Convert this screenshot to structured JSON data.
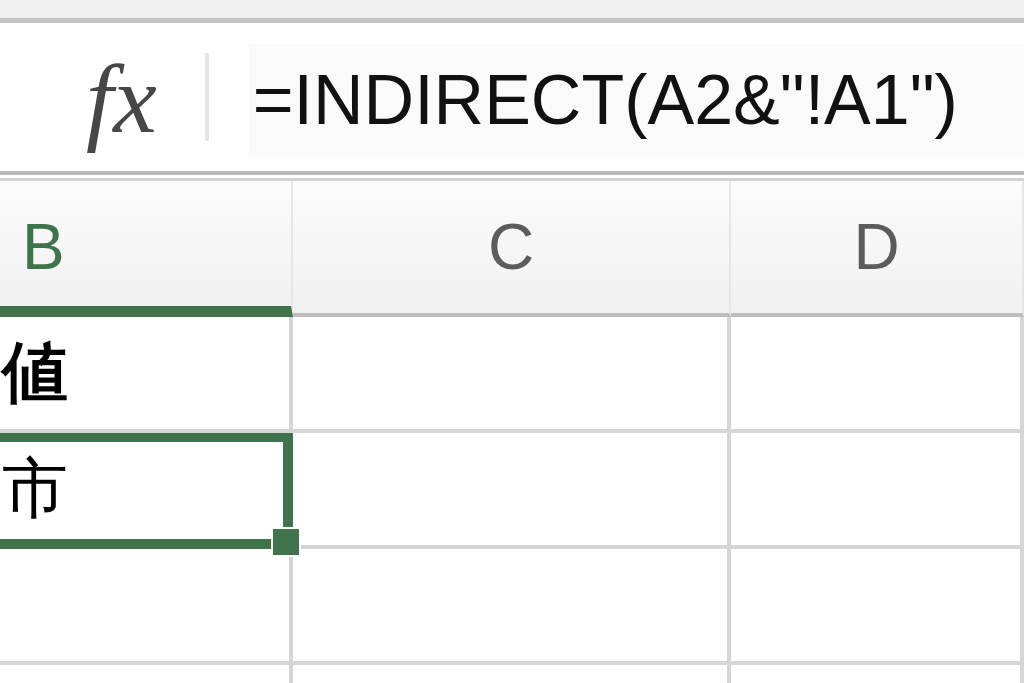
{
  "formula_bar": {
    "function_label": "fx",
    "formula": "=INDIRECT(A2&\"!A1\")"
  },
  "columns": [
    {
      "label": "B",
      "selected": true
    },
    {
      "label": "C",
      "selected": false
    },
    {
      "label": "D",
      "selected": false
    }
  ],
  "rows": [
    {
      "cells": [
        {
          "text": "値",
          "bold": true,
          "selected": false
        },
        {
          "selected": false
        },
        {
          "selected": false
        }
      ]
    },
    {
      "cells": [
        {
          "text": "市",
          "bold": false,
          "selected": true
        },
        {
          "selected": false
        },
        {
          "selected": false
        }
      ]
    },
    {
      "cells": [
        {
          "selected": false
        },
        {
          "selected": false
        },
        {
          "selected": false
        }
      ]
    }
  ]
}
